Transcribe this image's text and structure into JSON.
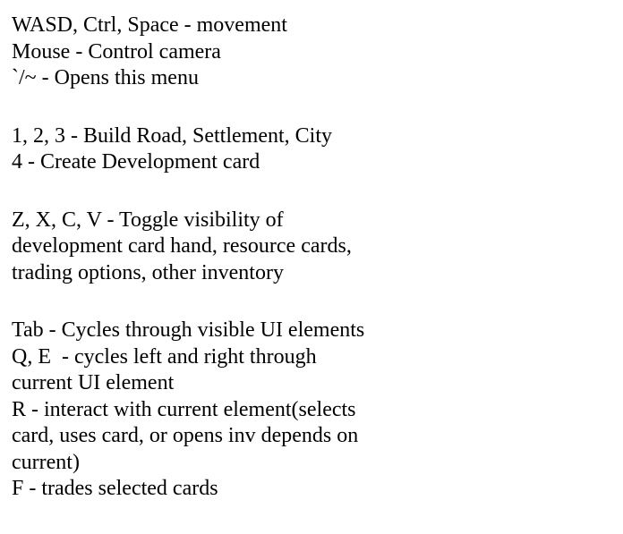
{
  "menu": {
    "sections": [
      {
        "lines": [
          "WASD, Ctrl, Space - movement",
          "Mouse - Control camera",
          "`/~ - Opens this menu"
        ]
      },
      {
        "lines": [
          "1, 2, 3 - Build Road, Settlement, City",
          "4 - Create Development card"
        ]
      },
      {
        "lines": [
          "Z, X, C, V - Toggle visibility of",
          "development card hand, resource cards,",
          "trading options, other inventory"
        ]
      },
      {
        "lines": [
          "Tab - Cycles through visible UI elements",
          "Q, E  - cycles left and right through",
          "current UI element",
          "R - interact with current element(selects",
          "card, uses card, or opens inv depends on",
          "current)",
          "F - trades selected cards"
        ]
      }
    ]
  }
}
